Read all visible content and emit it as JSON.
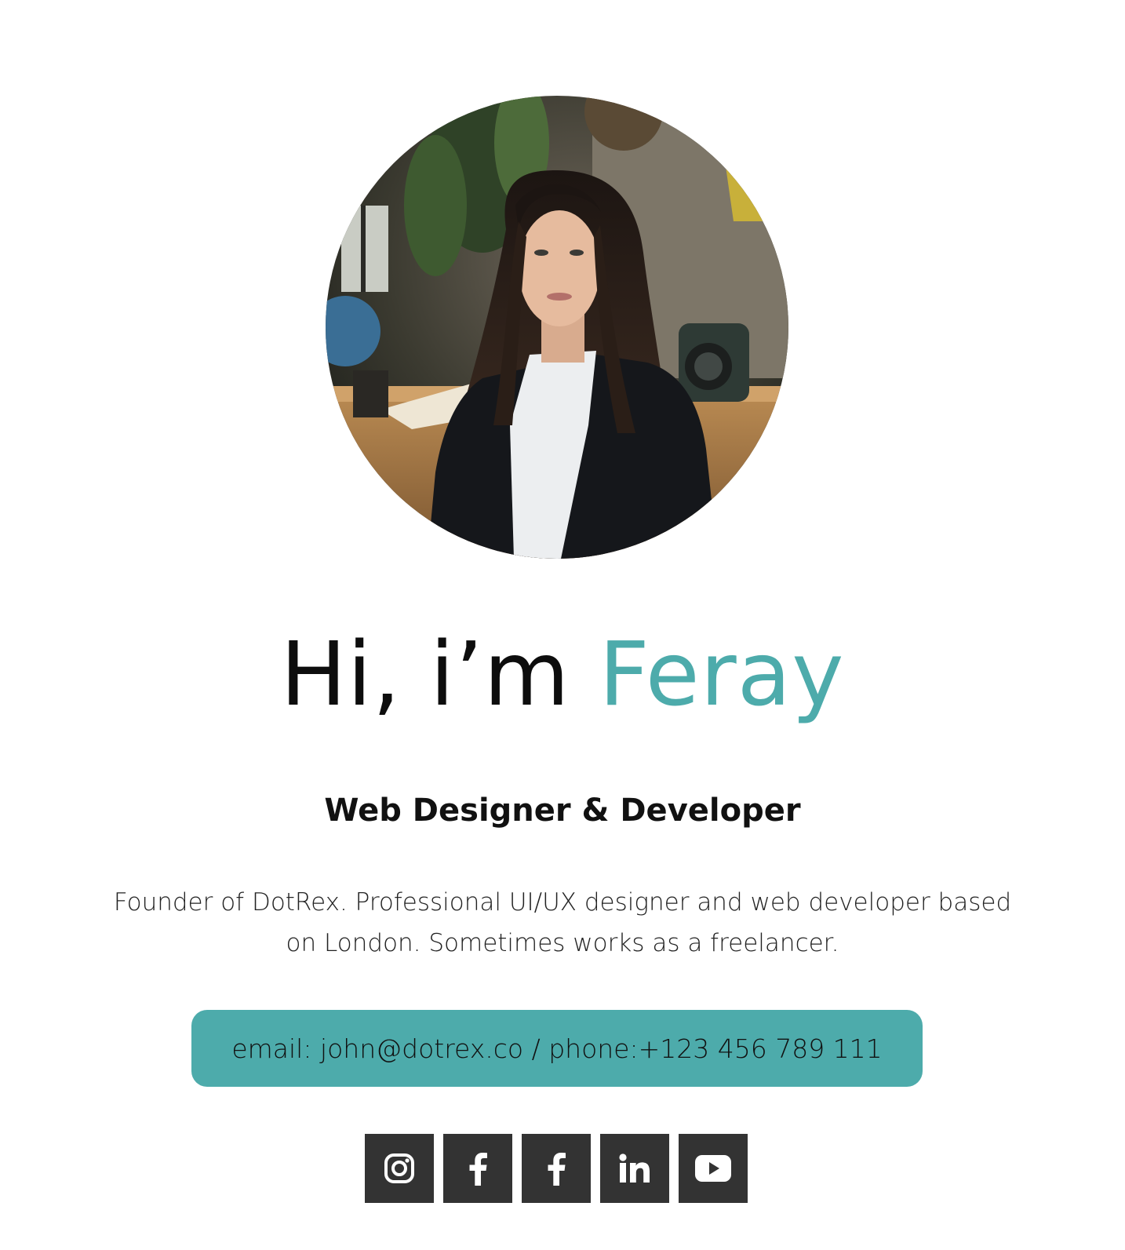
{
  "profile": {
    "greeting": "Hi, i’m ",
    "name": "Feray",
    "title": "Web Designer & Developer",
    "bio": "Founder of DotRex. Professional UI/UX designer and web developer based on London. Sometimes works as a freelancer.",
    "contact": "email: john@dotrex.co / phone:+123 456 789 111"
  },
  "colors": {
    "accent": "#4dabab",
    "social_bg": "#333333",
    "text": "#111111"
  },
  "socials": [
    {
      "icon": "instagram-icon"
    },
    {
      "icon": "facebook-icon"
    },
    {
      "icon": "facebook-icon"
    },
    {
      "icon": "linkedin-icon"
    },
    {
      "icon": "youtube-icon"
    }
  ]
}
